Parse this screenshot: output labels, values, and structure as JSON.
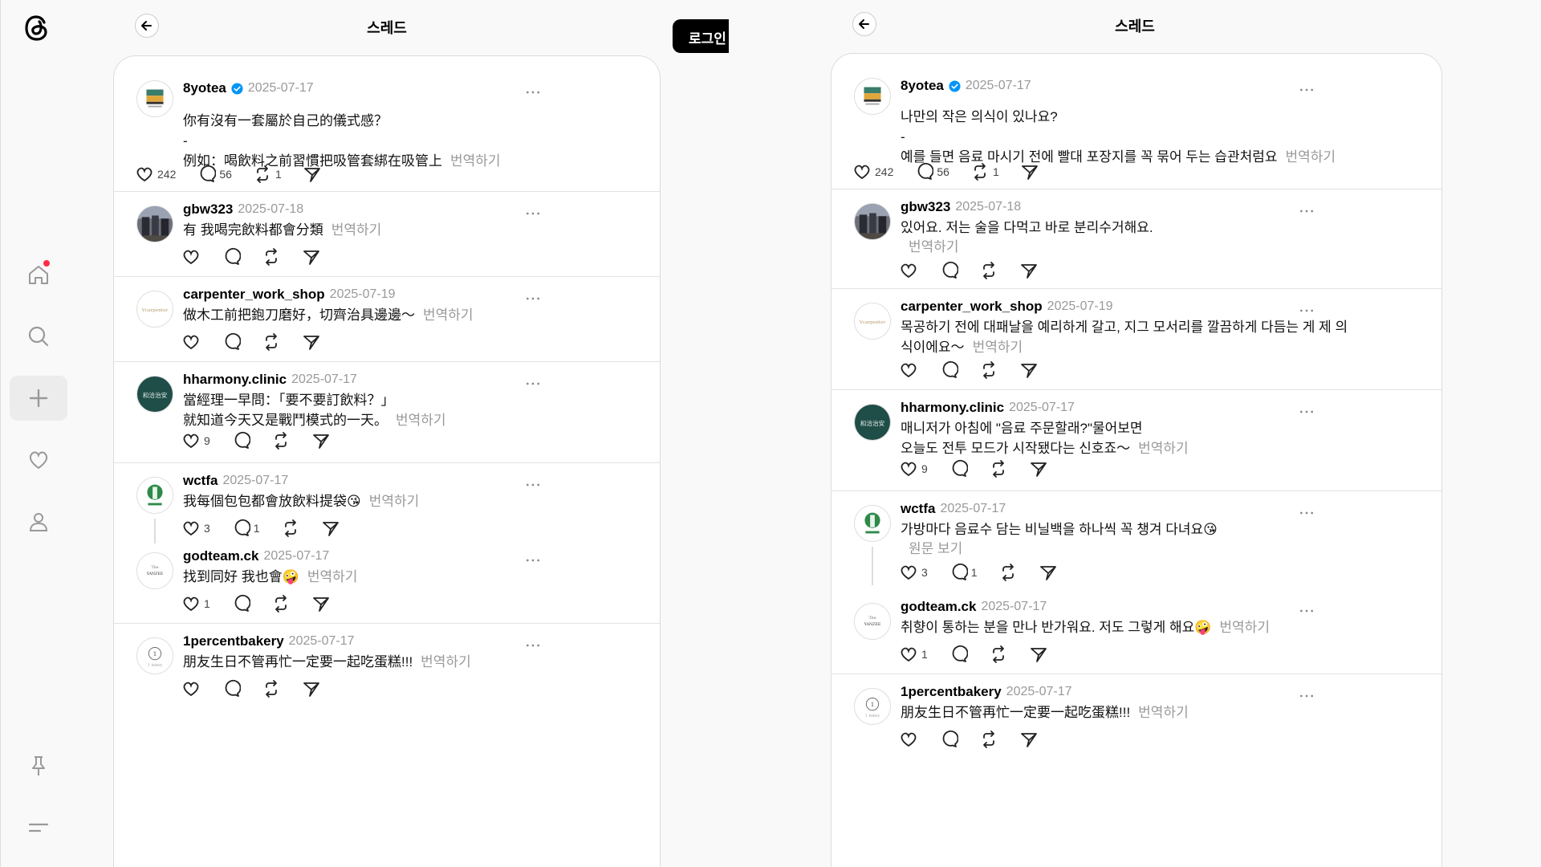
{
  "nav": {
    "items": [
      {
        "name": "home-icon"
      },
      {
        "name": "search-icon"
      },
      {
        "name": "create-icon"
      },
      {
        "name": "activity-icon"
      },
      {
        "name": "profile-icon"
      },
      {
        "name": "pin-icon"
      },
      {
        "name": "menu-icon"
      }
    ]
  },
  "login": {
    "label": "로그인"
  },
  "translate_label": "번역하기",
  "original_label": "원문 보기",
  "left": {
    "title": "스레드",
    "posts": [
      {
        "user": "8yotea",
        "date": "2025-07-17",
        "lines": [
          "你有沒有一套屬於自己的儀式感？",
          "-",
          "例如：喝飲料之前習慣把吸管套綁在吸管上"
        ],
        "likes": "242",
        "replies": "56",
        "reposts": "1"
      },
      {
        "user": "gbw323",
        "date": "2025-07-18",
        "lines": [
          "有 我喝完飲料都會分類"
        ]
      },
      {
        "user": "carpenter_work_shop",
        "date": "2025-07-19",
        "lines": [
          "做木工前把鉋刀磨好，切齊治具邊邊～"
        ]
      },
      {
        "user": "hharmony.clinic",
        "date": "2025-07-17",
        "lines": [
          "當經理一早問：「要不要訂飲料？」",
          "就知道今天又是戰鬥模式的一天。"
        ],
        "likes": "9"
      },
      {
        "user": "wctfa",
        "date": "2025-07-17",
        "lines": [
          "我每個包包都會放飲料提袋😘"
        ],
        "likes": "3",
        "replies": "1"
      },
      {
        "user": "godteam.ck",
        "date": "2025-07-17",
        "lines": [
          "找到同好 我也會🤪"
        ],
        "likes": "1"
      },
      {
        "user": "1percentbakery",
        "date": "2025-07-17",
        "lines": [
          "朋友生日不管再忙一定要一起吃蛋糕!!!"
        ]
      }
    ]
  },
  "right": {
    "title": "스레드",
    "posts": [
      {
        "user": "8yotea",
        "date": "2025-07-17",
        "lines": [
          "나만의 작은 의식이 있나요?",
          "-",
          "예를 들면 음료 마시기 전에 빨대 포장지를 꼭 묶어 두는 습관처럼요"
        ],
        "likes": "242",
        "replies": "56",
        "reposts": "1"
      },
      {
        "user": "gbw323",
        "date": "2025-07-18",
        "lines": [
          "있어요. 저는 술을 다먹고 바로 분리수거해요."
        ]
      },
      {
        "user": "carpenter_work_shop",
        "date": "2025-07-19",
        "lines": [
          "목공하기 전에 대패날을 예리하게 갈고, 지그 모서리를 깔끔하게 다듬는 게 제 의",
          "식이에요～"
        ]
      },
      {
        "user": "hharmony.clinic",
        "date": "2025-07-17",
        "lines": [
          "매니저가 아침에 \"음료 주문할래?\"물어보면",
          "오늘도 전투 모드가 시작됐다는 신호죠～"
        ],
        "likes": "9"
      },
      {
        "user": "wctfa",
        "date": "2025-07-17",
        "lines": [
          "가방마다 음료수 담는 비닐백을 하나씩 꼭 챙겨 다녀요😘"
        ],
        "likes": "3",
        "replies": "1"
      },
      {
        "user": "godteam.ck",
        "date": "2025-07-17",
        "lines": [
          "취향이 통하는 분을 만나 반가워요. 저도 그렇게 해요🤪"
        ],
        "likes": "1"
      },
      {
        "user": "1percentbakery",
        "date": "2025-07-17",
        "lines": [
          "朋友生日不管再忙一定要一起吃蛋糕!!!"
        ]
      }
    ]
  }
}
